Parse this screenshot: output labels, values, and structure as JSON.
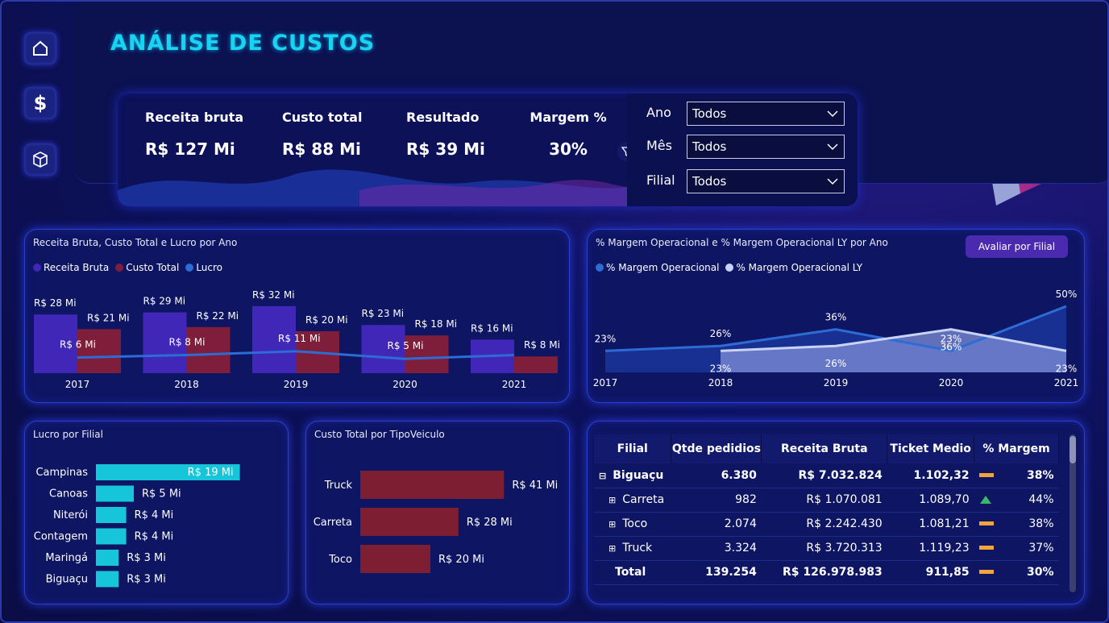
{
  "title": "ANÁLISE DE CUSTOS",
  "kpis": [
    {
      "label": "Receita bruta",
      "value": "R$ 127 Mi"
    },
    {
      "label": "Custo total",
      "value": "R$ 88 Mi"
    },
    {
      "label": "Resultado",
      "value": "R$ 39 Mi"
    },
    {
      "label": "Margem %",
      "value": "30%"
    }
  ],
  "filters": [
    {
      "label": "Ano",
      "value": "Todos"
    },
    {
      "label": "Mês",
      "value": "Todos"
    },
    {
      "label": "Filial",
      "value": "Todos"
    }
  ],
  "sidebar": [
    "home-icon",
    "dollar-icon",
    "box-icon"
  ],
  "charts": {
    "receita_custo_lucro": {
      "title": "Receita Bruta, Custo Total e Lucro por Ano",
      "legend": [
        "Receita Bruta",
        "Custo Total",
        "Lucro"
      ],
      "colors": {
        "receita": "#4127b8",
        "custo": "#7e1e3b",
        "lucro": "#2c6cd4"
      }
    },
    "margem": {
      "title": "% Margem Operacional e % Margem Operacional LY por Ano",
      "legend": [
        "% Margem Operacional",
        "% Margem Operacional LY"
      ],
      "button": "Avaliar por Filial",
      "colors": {
        "margem": "#2c6cd4",
        "ly": "#c9d3f5"
      }
    },
    "lucro_filial": {
      "title": "Lucro por Filial",
      "color": "#16c5da"
    },
    "custo_veiculo": {
      "title": "Custo Total por TipoVeiculo",
      "color": "#7e1e33"
    }
  },
  "chart_data": [
    {
      "type": "bar",
      "title": "Receita Bruta, Custo Total e Lucro por Ano",
      "categories": [
        "2017",
        "2018",
        "2019",
        "2020",
        "2021"
      ],
      "series": [
        {
          "name": "Receita Bruta",
          "values": [
            28,
            29,
            32,
            23,
            16
          ],
          "labels": [
            "R$ 28 Mi",
            "R$ 29 Mi",
            "R$ 32 Mi",
            "R$ 23 Mi",
            "R$ 16 Mi"
          ]
        },
        {
          "name": "Custo Total",
          "values": [
            21,
            22,
            20,
            18,
            8
          ],
          "labels": [
            "R$ 21 Mi",
            "R$ 22 Mi",
            "R$ 20 Mi",
            "R$ 18 Mi",
            "R$ 8 Mi"
          ]
        },
        {
          "name": "Lucro",
          "type": "line",
          "values": [
            6,
            8,
            11,
            5,
            8
          ],
          "labels": [
            "R$ 6 Mi",
            "R$ 8 Mi",
            "R$ 11 Mi",
            "R$ 5 Mi",
            ""
          ]
        }
      ]
    },
    {
      "type": "area",
      "title": "% Margem Operacional e % Margem Operacional LY por Ano",
      "categories": [
        "2017",
        "2018",
        "2019",
        "2020",
        "2021"
      ],
      "series": [
        {
          "name": "% Margem Operacional",
          "values": [
            23,
            26,
            36,
            23,
            50
          ],
          "labels": [
            "23%",
            "26%",
            "36%",
            "23%",
            "50%"
          ]
        },
        {
          "name": "% Margem Operacional LY",
          "values": [
            null,
            23,
            26,
            36,
            23
          ],
          "labels": [
            "",
            "23%",
            "26%",
            "36%",
            "23%"
          ]
        }
      ]
    },
    {
      "type": "bar",
      "orientation": "horizontal",
      "title": "Lucro por Filial",
      "categories": [
        "Campinas",
        "Canoas",
        "Niterói",
        "Contagem",
        "Maringá",
        "Biguaçu"
      ],
      "values": [
        19,
        5,
        4,
        4,
        3,
        3
      ],
      "labels": [
        "R$ 19 Mi",
        "R$ 5 Mi",
        "R$ 4 Mi",
        "R$ 4 Mi",
        "R$ 3 Mi",
        "R$ 3 Mi"
      ]
    },
    {
      "type": "bar",
      "orientation": "horizontal",
      "title": "Custo Total por TipoVeiculo",
      "categories": [
        "Truck",
        "Carreta",
        "Toco"
      ],
      "values": [
        41,
        28,
        20
      ],
      "labels": [
        "R$ 41 Mi",
        "R$ 28 Mi",
        "R$ 20 Mi"
      ]
    }
  ],
  "table": {
    "headers": [
      "Filial",
      "Qtde pedidios",
      "Receita Bruta",
      "Ticket Medio",
      "% Margem"
    ],
    "rows": [
      {
        "expand": "⊟",
        "name": "Biguaçu",
        "qtde": "6.380",
        "receita": "R$ 7.032.824",
        "ticket": "1.102,32",
        "status": "flat",
        "margem": "38%",
        "bold": true,
        "indent": false
      },
      {
        "expand": "⊞",
        "name": "Carreta",
        "qtde": "982",
        "receita": "R$ 1.070.081",
        "ticket": "1.089,70",
        "status": "up",
        "margem": "44%",
        "bold": false,
        "indent": true
      },
      {
        "expand": "⊞",
        "name": "Toco",
        "qtde": "2.074",
        "receita": "R$ 2.242.430",
        "ticket": "1.081,21",
        "status": "flat",
        "margem": "38%",
        "bold": false,
        "indent": true
      },
      {
        "expand": "⊞",
        "name": "Truck",
        "qtde": "3.324",
        "receita": "R$ 3.720.313",
        "ticket": "1.119,23",
        "status": "flat",
        "margem": "37%",
        "bold": false,
        "indent": true
      }
    ],
    "total": {
      "name": "Total",
      "qtde": "139.254",
      "receita": "R$ 126.978.983",
      "ticket": "911,85",
      "status": "flat",
      "margem": "30%"
    },
    "status_colors": {
      "flat": "#f0a63a",
      "up": "#3bb86a"
    }
  }
}
